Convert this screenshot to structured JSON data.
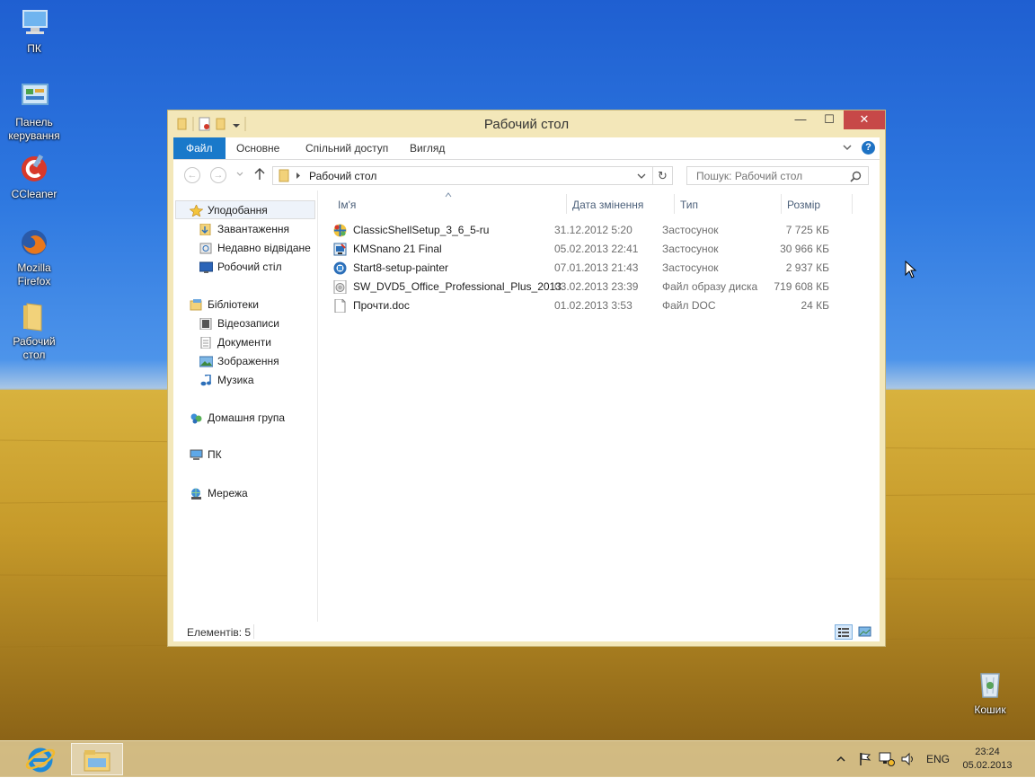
{
  "desktop": {
    "icons": [
      {
        "label": "ПК"
      },
      {
        "label": "Панель керування"
      },
      {
        "label": "CCleaner"
      },
      {
        "label": "Mozilla Firefox"
      },
      {
        "label": "Рабочий стол"
      },
      {
        "label": "Кошик"
      }
    ]
  },
  "window": {
    "title": "Рабочий стол",
    "controls": {
      "minimize": "—",
      "maximize": "☐",
      "close": "✕"
    },
    "ribbon": {
      "tabs": [
        "Файл",
        "Основне",
        "Спільний доступ",
        "Вигляд"
      ],
      "help": "?"
    },
    "address": {
      "path": "Рабочий стол",
      "search_placeholder": "Пошук: Рабочий стол"
    },
    "nav": {
      "favorites": "Уподобання",
      "fav_items": [
        "Завантаження",
        "Недавно відвідане",
        "Робочий стіл"
      ],
      "libraries": "Бібліотеки",
      "lib_items": [
        "Відеозаписи",
        "Документи",
        "Зображення",
        "Музика"
      ],
      "homegroup": "Домашня група",
      "pc": "ПК",
      "network": "Мережа"
    },
    "columns": {
      "name": "Ім'я",
      "date": "Дата змінення",
      "type": "Тип",
      "size": "Розмір"
    },
    "files": [
      {
        "name": "ClassicShellSetup_3_6_5-ru",
        "date": "31.12.2012 5:20",
        "type": "Застосунок",
        "size": "7 725 КБ",
        "icon": "classic-shell-icon"
      },
      {
        "name": "KMSnano 21 Final",
        "date": "05.02.2013 22:41",
        "type": "Застосунок",
        "size": "30 966 КБ",
        "icon": "kmsnano-icon"
      },
      {
        "name": "Start8-setup-painter",
        "date": "07.01.2013 21:43",
        "type": "Застосунок",
        "size": "2 937 КБ",
        "icon": "start8-icon"
      },
      {
        "name": "SW_DVD5_Office_Professional_Plus_2013...",
        "date": "03.02.2013 23:39",
        "type": "Файл образу диска",
        "size": "719 608 КБ",
        "icon": "disc-image-icon"
      },
      {
        "name": "Прочти.doc",
        "date": "01.02.2013 3:53",
        "type": "Файл DOC",
        "size": "24 КБ",
        "icon": "doc-file-icon"
      }
    ],
    "status": {
      "count": "Елементів: 5"
    }
  },
  "taskbar": {
    "language": "ENG",
    "time": "23:24",
    "date": "05.02.2013"
  },
  "colors": {
    "accent": "#1979ca",
    "close": "#c74848",
    "window_frame": "#f3e7b9"
  }
}
